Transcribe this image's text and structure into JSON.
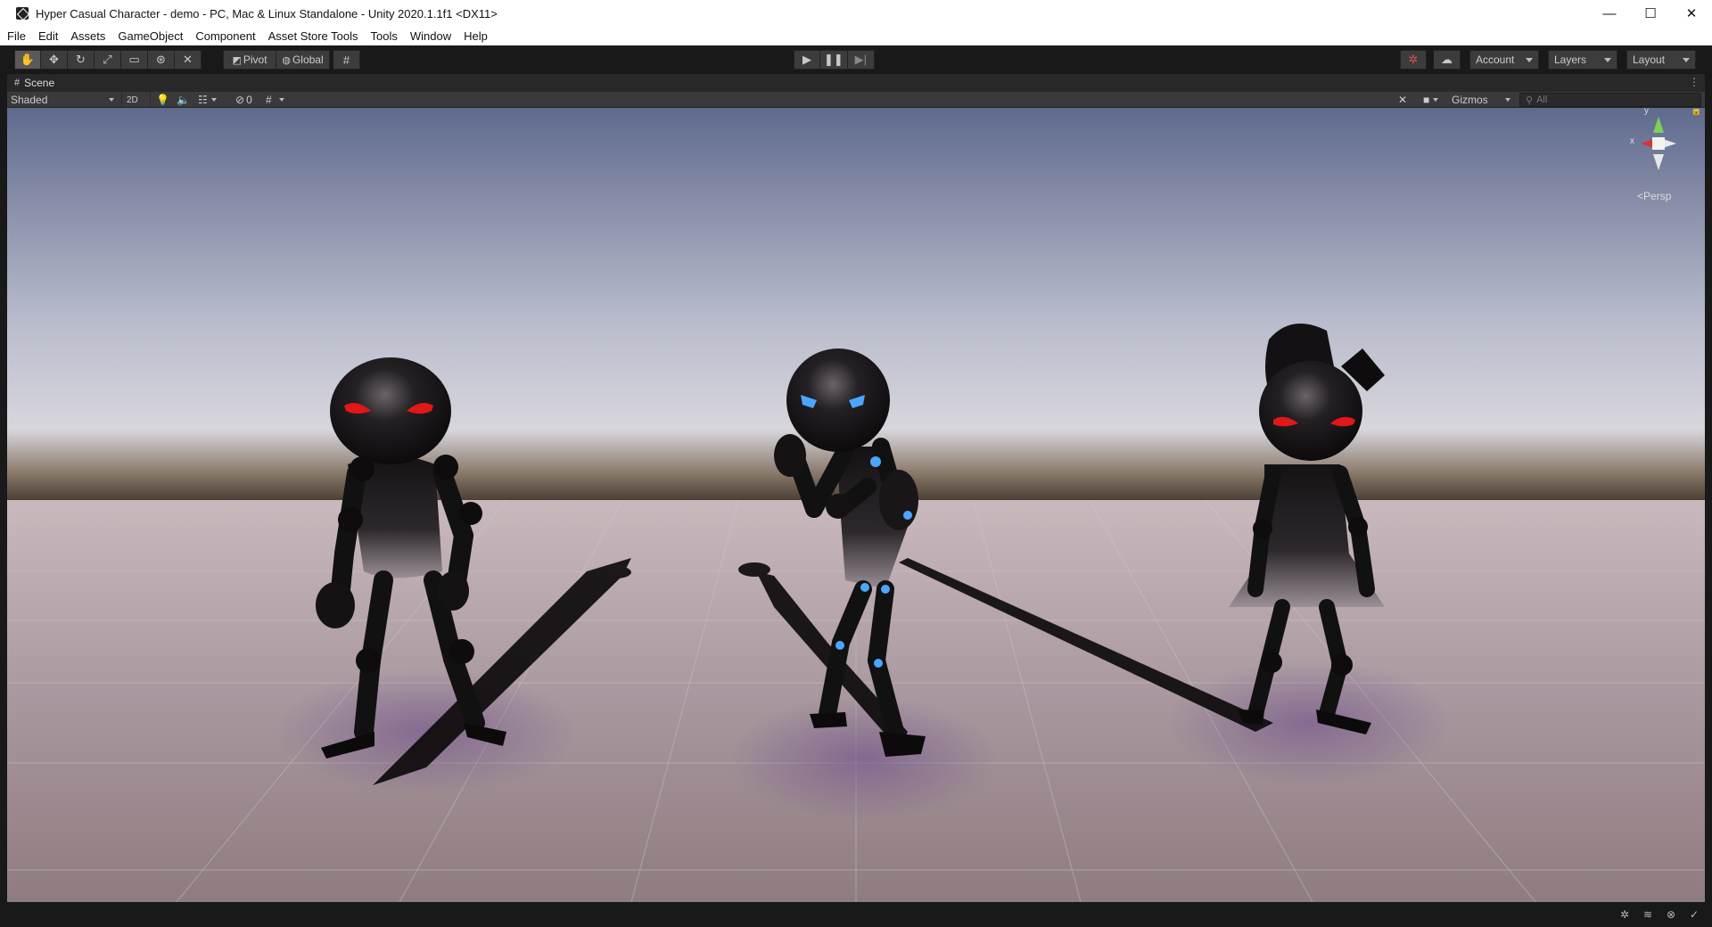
{
  "window": {
    "title": "Hyper Casual Character - demo - PC, Mac & Linux Standalone - Unity 2020.1.1f1 <DX11>",
    "minimize": "—",
    "maximize": "☐",
    "close": "✕"
  },
  "menu": {
    "items": [
      "File",
      "Edit",
      "Assets",
      "GameObject",
      "Component",
      "Asset Store Tools",
      "Tools",
      "Window",
      "Help"
    ]
  },
  "toolbar": {
    "tools": [
      "hand-tool",
      "move-tool",
      "rotate-tool",
      "scale-tool",
      "rect-tool",
      "transform-tool",
      "custom-tool"
    ],
    "pivot_label": "Pivot",
    "global_label": "Global",
    "account_label": "Account",
    "layers_label": "Layers",
    "layout_label": "Layout"
  },
  "scene_tab": {
    "label": "Scene"
  },
  "scene_toolbar": {
    "draw_mode": "Shaded",
    "mode_2d": "2D",
    "hidden_count": "0",
    "gizmos_label": "Gizmos",
    "search_placeholder": "All"
  },
  "viewport": {
    "projection": "Persp",
    "axis_x": "x",
    "axis_y": "y",
    "colors": {
      "sky_top": "#5f6a8e",
      "sky_mid": "#b9bccc",
      "horizon": "#5b4a3e",
      "ground": "#a8979e",
      "ground_far": "#c9b9bd",
      "character": "#141114",
      "eye_red": "#e01818",
      "eye_blue": "#4aa6ff"
    }
  }
}
